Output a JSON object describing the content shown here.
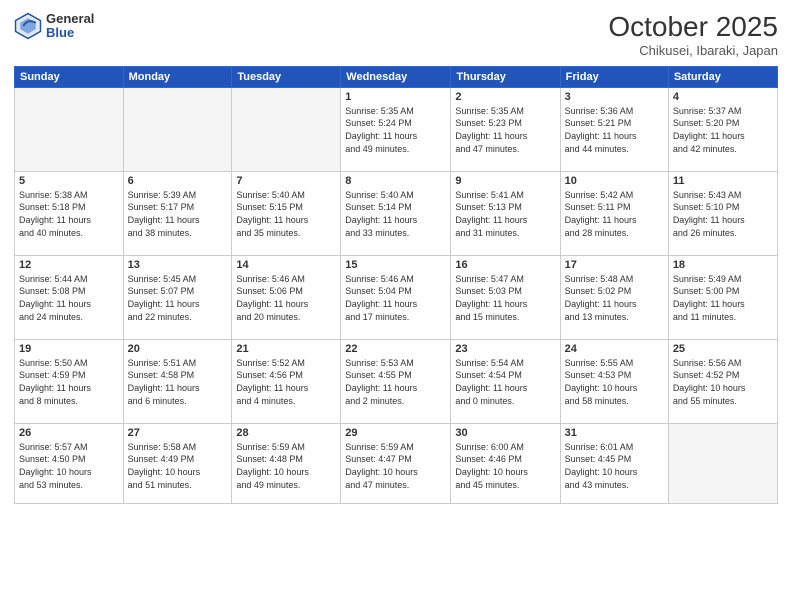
{
  "logo": {
    "general": "General",
    "blue": "Blue"
  },
  "title": "October 2025",
  "subtitle": "Chikusei, Ibaraki, Japan",
  "days_of_week": [
    "Sunday",
    "Monday",
    "Tuesday",
    "Wednesday",
    "Thursday",
    "Friday",
    "Saturday"
  ],
  "weeks": [
    [
      {
        "day": "",
        "info": ""
      },
      {
        "day": "",
        "info": ""
      },
      {
        "day": "",
        "info": ""
      },
      {
        "day": "1",
        "info": "Sunrise: 5:35 AM\nSunset: 5:24 PM\nDaylight: 11 hours\nand 49 minutes."
      },
      {
        "day": "2",
        "info": "Sunrise: 5:35 AM\nSunset: 5:23 PM\nDaylight: 11 hours\nand 47 minutes."
      },
      {
        "day": "3",
        "info": "Sunrise: 5:36 AM\nSunset: 5:21 PM\nDaylight: 11 hours\nand 44 minutes."
      },
      {
        "day": "4",
        "info": "Sunrise: 5:37 AM\nSunset: 5:20 PM\nDaylight: 11 hours\nand 42 minutes."
      }
    ],
    [
      {
        "day": "5",
        "info": "Sunrise: 5:38 AM\nSunset: 5:18 PM\nDaylight: 11 hours\nand 40 minutes."
      },
      {
        "day": "6",
        "info": "Sunrise: 5:39 AM\nSunset: 5:17 PM\nDaylight: 11 hours\nand 38 minutes."
      },
      {
        "day": "7",
        "info": "Sunrise: 5:40 AM\nSunset: 5:15 PM\nDaylight: 11 hours\nand 35 minutes."
      },
      {
        "day": "8",
        "info": "Sunrise: 5:40 AM\nSunset: 5:14 PM\nDaylight: 11 hours\nand 33 minutes."
      },
      {
        "day": "9",
        "info": "Sunrise: 5:41 AM\nSunset: 5:13 PM\nDaylight: 11 hours\nand 31 minutes."
      },
      {
        "day": "10",
        "info": "Sunrise: 5:42 AM\nSunset: 5:11 PM\nDaylight: 11 hours\nand 28 minutes."
      },
      {
        "day": "11",
        "info": "Sunrise: 5:43 AM\nSunset: 5:10 PM\nDaylight: 11 hours\nand 26 minutes."
      }
    ],
    [
      {
        "day": "12",
        "info": "Sunrise: 5:44 AM\nSunset: 5:08 PM\nDaylight: 11 hours\nand 24 minutes."
      },
      {
        "day": "13",
        "info": "Sunrise: 5:45 AM\nSunset: 5:07 PM\nDaylight: 11 hours\nand 22 minutes."
      },
      {
        "day": "14",
        "info": "Sunrise: 5:46 AM\nSunset: 5:06 PM\nDaylight: 11 hours\nand 20 minutes."
      },
      {
        "day": "15",
        "info": "Sunrise: 5:46 AM\nSunset: 5:04 PM\nDaylight: 11 hours\nand 17 minutes."
      },
      {
        "day": "16",
        "info": "Sunrise: 5:47 AM\nSunset: 5:03 PM\nDaylight: 11 hours\nand 15 minutes."
      },
      {
        "day": "17",
        "info": "Sunrise: 5:48 AM\nSunset: 5:02 PM\nDaylight: 11 hours\nand 13 minutes."
      },
      {
        "day": "18",
        "info": "Sunrise: 5:49 AM\nSunset: 5:00 PM\nDaylight: 11 hours\nand 11 minutes."
      }
    ],
    [
      {
        "day": "19",
        "info": "Sunrise: 5:50 AM\nSunset: 4:59 PM\nDaylight: 11 hours\nand 8 minutes."
      },
      {
        "day": "20",
        "info": "Sunrise: 5:51 AM\nSunset: 4:58 PM\nDaylight: 11 hours\nand 6 minutes."
      },
      {
        "day": "21",
        "info": "Sunrise: 5:52 AM\nSunset: 4:56 PM\nDaylight: 11 hours\nand 4 minutes."
      },
      {
        "day": "22",
        "info": "Sunrise: 5:53 AM\nSunset: 4:55 PM\nDaylight: 11 hours\nand 2 minutes."
      },
      {
        "day": "23",
        "info": "Sunrise: 5:54 AM\nSunset: 4:54 PM\nDaylight: 11 hours\nand 0 minutes."
      },
      {
        "day": "24",
        "info": "Sunrise: 5:55 AM\nSunset: 4:53 PM\nDaylight: 10 hours\nand 58 minutes."
      },
      {
        "day": "25",
        "info": "Sunrise: 5:56 AM\nSunset: 4:52 PM\nDaylight: 10 hours\nand 55 minutes."
      }
    ],
    [
      {
        "day": "26",
        "info": "Sunrise: 5:57 AM\nSunset: 4:50 PM\nDaylight: 10 hours\nand 53 minutes."
      },
      {
        "day": "27",
        "info": "Sunrise: 5:58 AM\nSunset: 4:49 PM\nDaylight: 10 hours\nand 51 minutes."
      },
      {
        "day": "28",
        "info": "Sunrise: 5:59 AM\nSunset: 4:48 PM\nDaylight: 10 hours\nand 49 minutes."
      },
      {
        "day": "29",
        "info": "Sunrise: 5:59 AM\nSunset: 4:47 PM\nDaylight: 10 hours\nand 47 minutes."
      },
      {
        "day": "30",
        "info": "Sunrise: 6:00 AM\nSunset: 4:46 PM\nDaylight: 10 hours\nand 45 minutes."
      },
      {
        "day": "31",
        "info": "Sunrise: 6:01 AM\nSunset: 4:45 PM\nDaylight: 10 hours\nand 43 minutes."
      },
      {
        "day": "",
        "info": ""
      }
    ]
  ]
}
